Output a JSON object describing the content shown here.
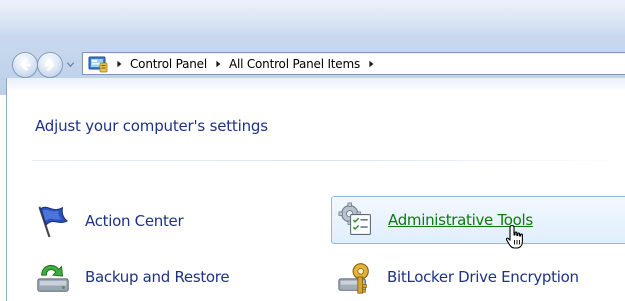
{
  "nav": {
    "back_icon": "back-arrow-icon",
    "forward_icon": "forward-arrow-icon",
    "recent_icon": "chevron-down-icon"
  },
  "address_bar": {
    "icon": "control-panel-icon",
    "breadcrumbs": [
      "Control Panel",
      "All Control Panel Items"
    ]
  },
  "main": {
    "title": "Adjust your computer's settings",
    "items": [
      {
        "label": "Action Center",
        "icon": "flag-icon"
      },
      {
        "label": "Administrative Tools",
        "icon": "admin-tools-icon",
        "state": "hover"
      },
      {
        "label": "Backup and Restore",
        "icon": "backup-icon"
      },
      {
        "label": "BitLocker Drive Encryption",
        "icon": "bitlocker-key-icon"
      }
    ]
  },
  "colors": {
    "link": "#1e3287",
    "link_hover": "#0f7a0f",
    "hover_border": "#8fb8e3"
  }
}
